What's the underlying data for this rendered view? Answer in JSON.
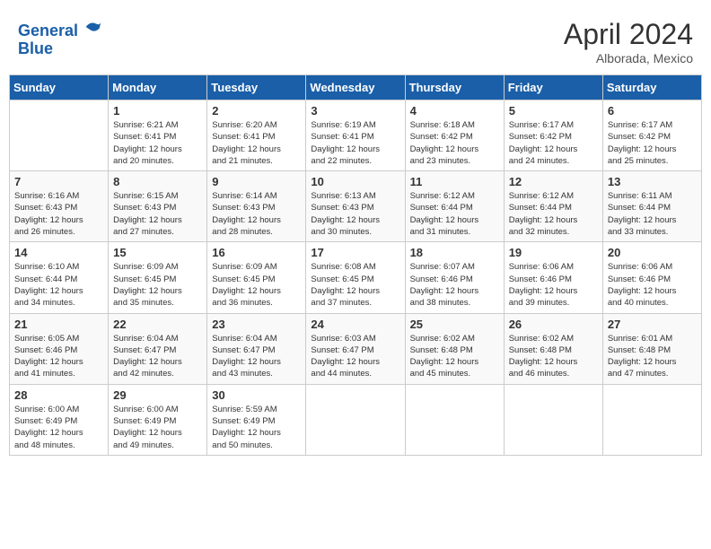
{
  "header": {
    "logo_line1": "General",
    "logo_line2": "Blue",
    "month_year": "April 2024",
    "location": "Alborada, Mexico"
  },
  "days_of_week": [
    "Sunday",
    "Monday",
    "Tuesday",
    "Wednesday",
    "Thursday",
    "Friday",
    "Saturday"
  ],
  "weeks": [
    [
      {
        "day": "",
        "info": ""
      },
      {
        "day": "1",
        "info": "Sunrise: 6:21 AM\nSunset: 6:41 PM\nDaylight: 12 hours\nand 20 minutes."
      },
      {
        "day": "2",
        "info": "Sunrise: 6:20 AM\nSunset: 6:41 PM\nDaylight: 12 hours\nand 21 minutes."
      },
      {
        "day": "3",
        "info": "Sunrise: 6:19 AM\nSunset: 6:41 PM\nDaylight: 12 hours\nand 22 minutes."
      },
      {
        "day": "4",
        "info": "Sunrise: 6:18 AM\nSunset: 6:42 PM\nDaylight: 12 hours\nand 23 minutes."
      },
      {
        "day": "5",
        "info": "Sunrise: 6:17 AM\nSunset: 6:42 PM\nDaylight: 12 hours\nand 24 minutes."
      },
      {
        "day": "6",
        "info": "Sunrise: 6:17 AM\nSunset: 6:42 PM\nDaylight: 12 hours\nand 25 minutes."
      }
    ],
    [
      {
        "day": "7",
        "info": "Sunrise: 6:16 AM\nSunset: 6:43 PM\nDaylight: 12 hours\nand 26 minutes."
      },
      {
        "day": "8",
        "info": "Sunrise: 6:15 AM\nSunset: 6:43 PM\nDaylight: 12 hours\nand 27 minutes."
      },
      {
        "day": "9",
        "info": "Sunrise: 6:14 AM\nSunset: 6:43 PM\nDaylight: 12 hours\nand 28 minutes."
      },
      {
        "day": "10",
        "info": "Sunrise: 6:13 AM\nSunset: 6:43 PM\nDaylight: 12 hours\nand 30 minutes."
      },
      {
        "day": "11",
        "info": "Sunrise: 6:12 AM\nSunset: 6:44 PM\nDaylight: 12 hours\nand 31 minutes."
      },
      {
        "day": "12",
        "info": "Sunrise: 6:12 AM\nSunset: 6:44 PM\nDaylight: 12 hours\nand 32 minutes."
      },
      {
        "day": "13",
        "info": "Sunrise: 6:11 AM\nSunset: 6:44 PM\nDaylight: 12 hours\nand 33 minutes."
      }
    ],
    [
      {
        "day": "14",
        "info": "Sunrise: 6:10 AM\nSunset: 6:44 PM\nDaylight: 12 hours\nand 34 minutes."
      },
      {
        "day": "15",
        "info": "Sunrise: 6:09 AM\nSunset: 6:45 PM\nDaylight: 12 hours\nand 35 minutes."
      },
      {
        "day": "16",
        "info": "Sunrise: 6:09 AM\nSunset: 6:45 PM\nDaylight: 12 hours\nand 36 minutes."
      },
      {
        "day": "17",
        "info": "Sunrise: 6:08 AM\nSunset: 6:45 PM\nDaylight: 12 hours\nand 37 minutes."
      },
      {
        "day": "18",
        "info": "Sunrise: 6:07 AM\nSunset: 6:46 PM\nDaylight: 12 hours\nand 38 minutes."
      },
      {
        "day": "19",
        "info": "Sunrise: 6:06 AM\nSunset: 6:46 PM\nDaylight: 12 hours\nand 39 minutes."
      },
      {
        "day": "20",
        "info": "Sunrise: 6:06 AM\nSunset: 6:46 PM\nDaylight: 12 hours\nand 40 minutes."
      }
    ],
    [
      {
        "day": "21",
        "info": "Sunrise: 6:05 AM\nSunset: 6:46 PM\nDaylight: 12 hours\nand 41 minutes."
      },
      {
        "day": "22",
        "info": "Sunrise: 6:04 AM\nSunset: 6:47 PM\nDaylight: 12 hours\nand 42 minutes."
      },
      {
        "day": "23",
        "info": "Sunrise: 6:04 AM\nSunset: 6:47 PM\nDaylight: 12 hours\nand 43 minutes."
      },
      {
        "day": "24",
        "info": "Sunrise: 6:03 AM\nSunset: 6:47 PM\nDaylight: 12 hours\nand 44 minutes."
      },
      {
        "day": "25",
        "info": "Sunrise: 6:02 AM\nSunset: 6:48 PM\nDaylight: 12 hours\nand 45 minutes."
      },
      {
        "day": "26",
        "info": "Sunrise: 6:02 AM\nSunset: 6:48 PM\nDaylight: 12 hours\nand 46 minutes."
      },
      {
        "day": "27",
        "info": "Sunrise: 6:01 AM\nSunset: 6:48 PM\nDaylight: 12 hours\nand 47 minutes."
      }
    ],
    [
      {
        "day": "28",
        "info": "Sunrise: 6:00 AM\nSunset: 6:49 PM\nDaylight: 12 hours\nand 48 minutes."
      },
      {
        "day": "29",
        "info": "Sunrise: 6:00 AM\nSunset: 6:49 PM\nDaylight: 12 hours\nand 49 minutes."
      },
      {
        "day": "30",
        "info": "Sunrise: 5:59 AM\nSunset: 6:49 PM\nDaylight: 12 hours\nand 50 minutes."
      },
      {
        "day": "",
        "info": ""
      },
      {
        "day": "",
        "info": ""
      },
      {
        "day": "",
        "info": ""
      },
      {
        "day": "",
        "info": ""
      }
    ]
  ]
}
